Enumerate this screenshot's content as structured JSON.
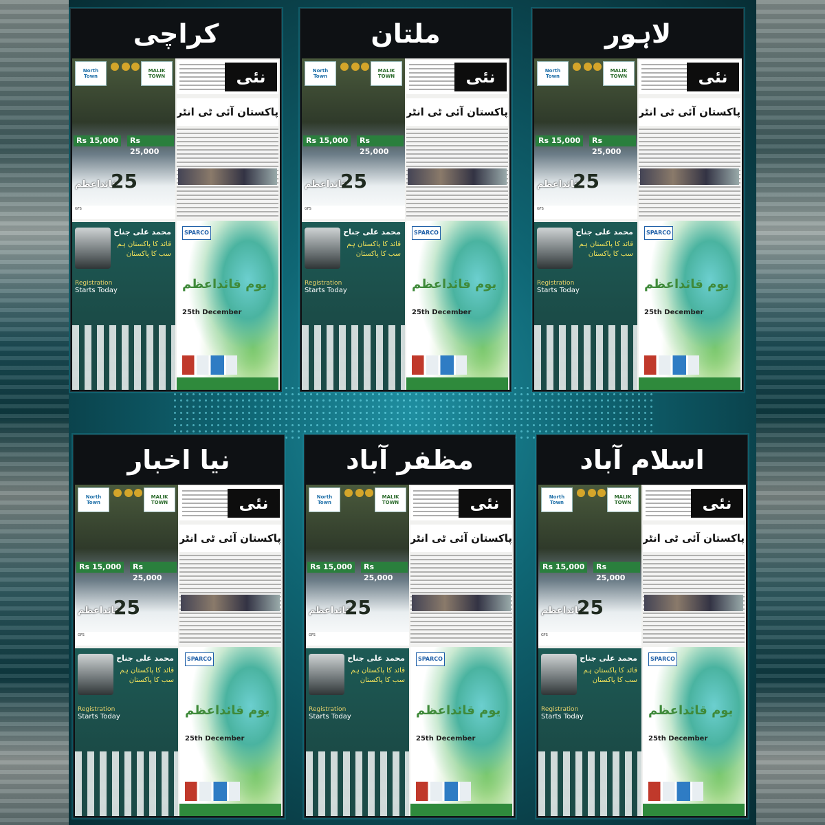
{
  "panels": [
    {
      "city": "کراچی"
    },
    {
      "city": "ملتان"
    },
    {
      "city": "لاہور"
    },
    {
      "city": "نیا اخبار"
    },
    {
      "city": "مظفر آباد"
    },
    {
      "city": "اسلام آباد"
    }
  ],
  "newspaper": {
    "masthead": "نئی بات",
    "headline": "پاکستان آئی ٹی انٹرپرائزز کی کارروائی شروع"
  },
  "ad_property": {
    "logo_left": "North Town",
    "logo_right": "MALIK TOWN",
    "price_1": "Rs 15,000",
    "price_2": "Rs 25,000",
    "number_25": "25",
    "quaid_text": "قائداعظم",
    "logo_gfs": "GFS"
  },
  "ad_expo": {
    "jinnah_name": "محمد علی جناح",
    "tagline": "قائد کا پاکستان ہم سب کا پاکستان",
    "registration_line1": "Registration",
    "registration_line2": "Starts Today"
  },
  "ad_paint": {
    "brand": "SPARCO",
    "youm_title": "یوم قائداعظم",
    "date": "25th December"
  }
}
